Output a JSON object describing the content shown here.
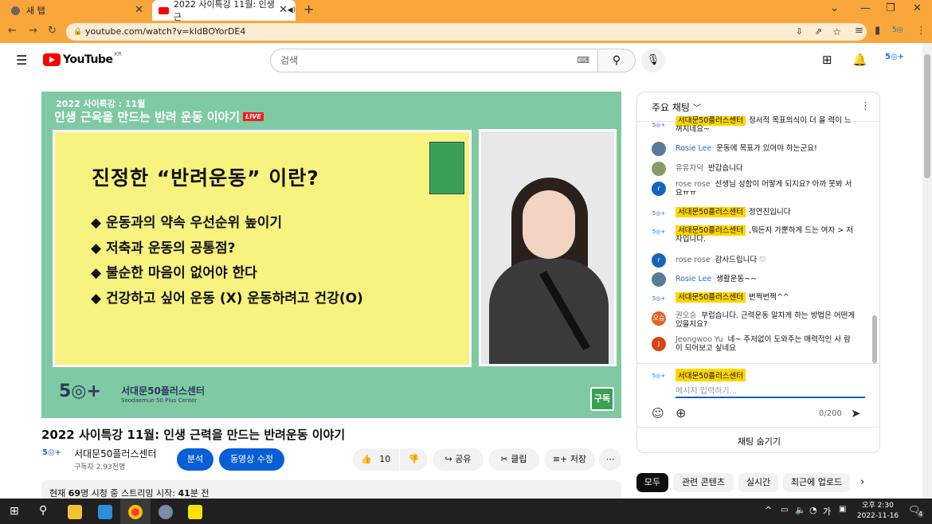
{
  "browser": {
    "tab1_title": "새 탭",
    "tab2_title": "2022 사이특강 11월: 인생 근",
    "url": "youtube.com/watch?v=kldBOYorDE4"
  },
  "yt": {
    "logo": "YouTube",
    "region": "KR",
    "search_placeholder": "검색"
  },
  "video": {
    "banner_line1": "2022 사이특강 : 11월",
    "banner_line2": "인생 근육을 만드는 반려 운동 이야기",
    "live": "LIVE",
    "slide_title": "진정한 “반려운동” 이란?",
    "bullets": [
      "◆ 운동과의 약속 우선순위 높이기",
      "◆ 저축과 운동의 공통점?",
      "◆ 불순한 마음이 없어야 한다",
      "◆ 건강하고 싶어 운동 (X) 운동하려고 건강(O)"
    ],
    "footer_org": "서대문50플러스센터",
    "footer_org_en": "Seodaemun 50 Plus Center",
    "subscribe_badge": "구독"
  },
  "meta": {
    "title": "2022 사이특강 11월: 인생 근력을 만드는 반려운동 이야기",
    "channel": "서대문50플러스센터",
    "subscribers": "구독자 2.93천명",
    "analytics": "분석",
    "edit": "동영상 수정",
    "likes": "10",
    "share": "공유",
    "clip": "클립",
    "save": "저장",
    "desc_prefix": "현재 ",
    "desc_viewers": "69",
    "desc_mid": "명 시청 중 스트리밍 시작: ",
    "desc_min": "41",
    "desc_suffix": "분 전"
  },
  "chat": {
    "header": "주요 채팅",
    "messages": [
      {
        "name": "서대문50플러스센터",
        "text": "정서적 목표의식이 더 을 력이 느껴지네요~",
        "owner": true
      },
      {
        "name": "Rosie Lee",
        "text": "운동에 목표가 있어야 하는군요!",
        "owner": false
      },
      {
        "name": "유유자덕",
        "text": "반갑습니다",
        "owner": false
      },
      {
        "name": "rose rose",
        "text": "선생님 성함이 어떻게 되지요? 아까 못봐 서요ㅠㅠ",
        "owner": false
      },
      {
        "name": "서대문50플러스센터",
        "text": "정연진입니다",
        "owner": true
      },
      {
        "name": "서대문50플러스센터",
        "text": ",뭐든지 가뿐하게 드는 여자 > 저자입니다.",
        "owner": true
      },
      {
        "name": "rose rose",
        "text": "감사드립니다 ♡",
        "owner": false
      },
      {
        "name": "Rosie Lee",
        "text": "생활운동~~",
        "owner": false
      },
      {
        "name": "서대문50플러스센터",
        "text": "번쩍번쩍^^",
        "owner": true
      },
      {
        "name": "권오승",
        "text": "부럽습니다. 근력운동 알차게 하는 방법은 어떤게 있을지요?",
        "owner": false
      },
      {
        "name": "Jeongwoo Yu",
        "text": "네~ 주저없이 도와주는 매력적인 사 람이 되어보고 싶네요",
        "owner": false
      }
    ],
    "input_name": "서대문50플러스센터",
    "input_placeholder": "메시지 입력하기...",
    "counter": "0/200",
    "hide": "채팅 숨기기"
  },
  "chips": [
    "모두",
    "관련 콘텐츠",
    "실시간",
    "최근에 업로드"
  ],
  "taskbar": {
    "time": "오후 2:30",
    "date": "2022-11-16",
    "ime": "가",
    "notif": "4"
  },
  "colors": {
    "accent": "#065fd4",
    "owner_badge": "#ffd600",
    "browser_frame": "#f9a63a",
    "video_bg": "#7fc9a4"
  }
}
